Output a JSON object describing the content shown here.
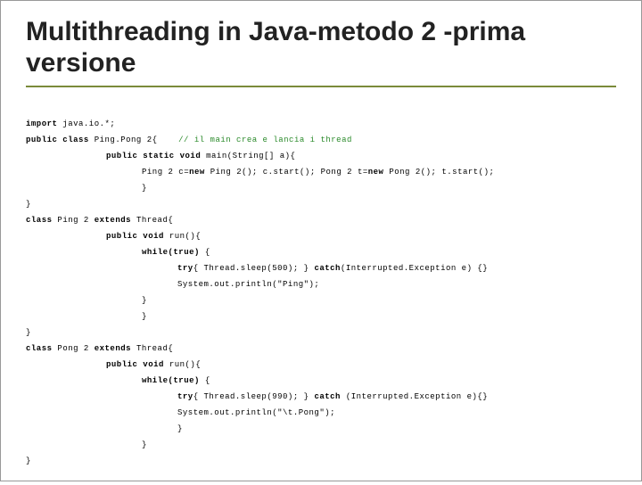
{
  "title": "Multithreading in Java-metodo 2 -prima versione",
  "code": {
    "l01a": "import",
    "l01b": " java.io.*;",
    "l02a": "public class",
    "l02b": " Ping.Pong 2{",
    "l02c": "// il main crea e lancia i thread",
    "l03a": "public static void",
    "l03b": " main(String[] a){",
    "l04a": "Ping 2 c=",
    "l04b": "new",
    "l04c": " Ping 2(); c.start(); Pong 2 t=",
    "l04d": "new",
    "l04e": " Pong 2(); t.start();",
    "l05": "}",
    "l06": "}",
    "l07a": "class",
    "l07b": " Ping 2 ",
    "l07c": "extends",
    "l07d": " Thread{",
    "l08a": "public void",
    "l08b": " run(){",
    "l09a": "while(true)",
    "l09b": " {",
    "l10a": "try",
    "l10b": "{ Thread.sleep(500); } ",
    "l10c": "catch",
    "l10d": "(Interrupted.Exception e) {}",
    "l11": "System.out.println(\"Ping\");",
    "l12": "}",
    "l13": "}",
    "l14": "}",
    "l15a": "class",
    "l15b": " Pong 2 ",
    "l15c": "extends",
    "l15d": " Thread{",
    "l16a": "public void",
    "l16b": " run(){",
    "l17a": "while(true)",
    "l17b": " {",
    "l18a": "try",
    "l18b": "{ Thread.sleep(990); } ",
    "l18c": "catch",
    "l18d": " (Interrupted.Exception e){}",
    "l19": "System.out.println(\"\\t.Pong\");",
    "l20": "}",
    "l21": "}",
    "l22": "}"
  }
}
